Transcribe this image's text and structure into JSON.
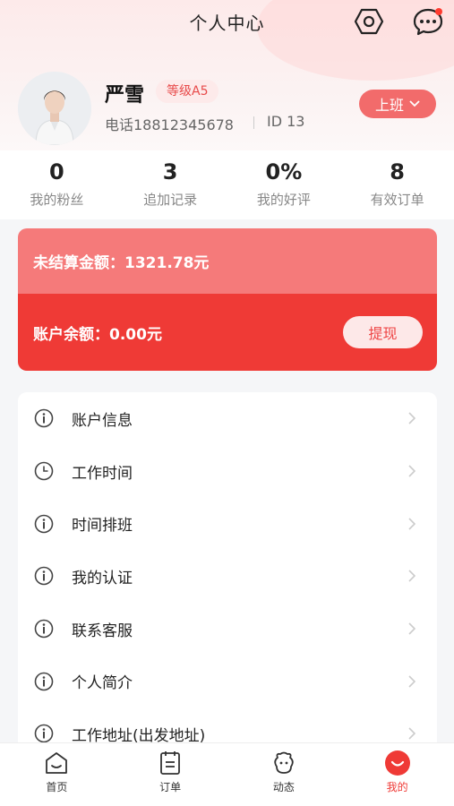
{
  "header": {
    "title": "个人中心"
  },
  "profile": {
    "name": "严雪",
    "level": "等级A5",
    "phone": "电话18812345678",
    "id": "ID 13",
    "shift_label": "上班"
  },
  "stats": [
    {
      "value": "0",
      "label": "我的粉丝"
    },
    {
      "value": "3",
      "label": "追加记录"
    },
    {
      "value": "0%",
      "label": "我的好评"
    },
    {
      "value": "8",
      "label": "有效订单"
    }
  ],
  "balance": {
    "unsettled_label": "未结算金额：",
    "unsettled_amount": "1321.78元",
    "account_label": "账户余额：",
    "account_amount": "0.00元",
    "withdraw_label": "提现"
  },
  "menu": [
    {
      "label": "账户信息",
      "icon": "info-icon"
    },
    {
      "label": "工作时间",
      "icon": "clock-icon"
    },
    {
      "label": "时间排班",
      "icon": "info-icon"
    },
    {
      "label": "我的认证",
      "icon": "info-icon"
    },
    {
      "label": "联系客服",
      "icon": "info-icon"
    },
    {
      "label": "个人简介",
      "icon": "info-icon"
    },
    {
      "label": "工作地址(出发地址)",
      "icon": "info-icon"
    }
  ],
  "tabbar": [
    {
      "label": "首页",
      "icon": "home-icon"
    },
    {
      "label": "订单",
      "icon": "order-icon"
    },
    {
      "label": "动态",
      "icon": "feed-icon"
    },
    {
      "label": "我的",
      "icon": "profile-icon",
      "active": true
    }
  ],
  "colors": {
    "accent": "#ef3a36",
    "accent_light": "#f57a7a",
    "badge_bg": "#fdeaea"
  }
}
